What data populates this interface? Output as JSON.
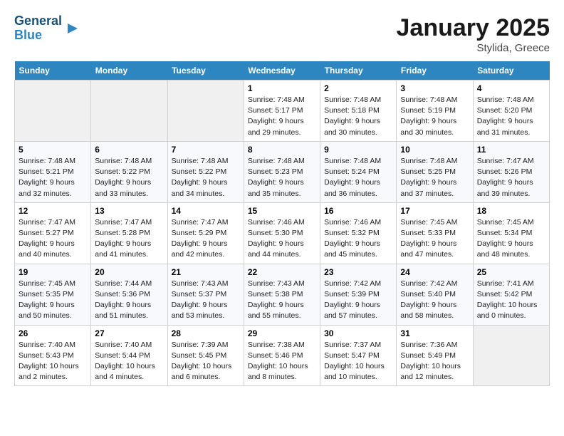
{
  "header": {
    "logo_line1": "General",
    "logo_line2": "Blue",
    "month": "January 2025",
    "location": "Stylida, Greece"
  },
  "weekdays": [
    "Sunday",
    "Monday",
    "Tuesday",
    "Wednesday",
    "Thursday",
    "Friday",
    "Saturday"
  ],
  "weeks": [
    [
      {
        "day": "",
        "info": ""
      },
      {
        "day": "",
        "info": ""
      },
      {
        "day": "",
        "info": ""
      },
      {
        "day": "1",
        "info": "Sunrise: 7:48 AM\nSunset: 5:17 PM\nDaylight: 9 hours\nand 29 minutes."
      },
      {
        "day": "2",
        "info": "Sunrise: 7:48 AM\nSunset: 5:18 PM\nDaylight: 9 hours\nand 30 minutes."
      },
      {
        "day": "3",
        "info": "Sunrise: 7:48 AM\nSunset: 5:19 PM\nDaylight: 9 hours\nand 30 minutes."
      },
      {
        "day": "4",
        "info": "Sunrise: 7:48 AM\nSunset: 5:20 PM\nDaylight: 9 hours\nand 31 minutes."
      }
    ],
    [
      {
        "day": "5",
        "info": "Sunrise: 7:48 AM\nSunset: 5:21 PM\nDaylight: 9 hours\nand 32 minutes."
      },
      {
        "day": "6",
        "info": "Sunrise: 7:48 AM\nSunset: 5:22 PM\nDaylight: 9 hours\nand 33 minutes."
      },
      {
        "day": "7",
        "info": "Sunrise: 7:48 AM\nSunset: 5:22 PM\nDaylight: 9 hours\nand 34 minutes."
      },
      {
        "day": "8",
        "info": "Sunrise: 7:48 AM\nSunset: 5:23 PM\nDaylight: 9 hours\nand 35 minutes."
      },
      {
        "day": "9",
        "info": "Sunrise: 7:48 AM\nSunset: 5:24 PM\nDaylight: 9 hours\nand 36 minutes."
      },
      {
        "day": "10",
        "info": "Sunrise: 7:48 AM\nSunset: 5:25 PM\nDaylight: 9 hours\nand 37 minutes."
      },
      {
        "day": "11",
        "info": "Sunrise: 7:47 AM\nSunset: 5:26 PM\nDaylight: 9 hours\nand 39 minutes."
      }
    ],
    [
      {
        "day": "12",
        "info": "Sunrise: 7:47 AM\nSunset: 5:27 PM\nDaylight: 9 hours\nand 40 minutes."
      },
      {
        "day": "13",
        "info": "Sunrise: 7:47 AM\nSunset: 5:28 PM\nDaylight: 9 hours\nand 41 minutes."
      },
      {
        "day": "14",
        "info": "Sunrise: 7:47 AM\nSunset: 5:29 PM\nDaylight: 9 hours\nand 42 minutes."
      },
      {
        "day": "15",
        "info": "Sunrise: 7:46 AM\nSunset: 5:30 PM\nDaylight: 9 hours\nand 44 minutes."
      },
      {
        "day": "16",
        "info": "Sunrise: 7:46 AM\nSunset: 5:32 PM\nDaylight: 9 hours\nand 45 minutes."
      },
      {
        "day": "17",
        "info": "Sunrise: 7:45 AM\nSunset: 5:33 PM\nDaylight: 9 hours\nand 47 minutes."
      },
      {
        "day": "18",
        "info": "Sunrise: 7:45 AM\nSunset: 5:34 PM\nDaylight: 9 hours\nand 48 minutes."
      }
    ],
    [
      {
        "day": "19",
        "info": "Sunrise: 7:45 AM\nSunset: 5:35 PM\nDaylight: 9 hours\nand 50 minutes."
      },
      {
        "day": "20",
        "info": "Sunrise: 7:44 AM\nSunset: 5:36 PM\nDaylight: 9 hours\nand 51 minutes."
      },
      {
        "day": "21",
        "info": "Sunrise: 7:43 AM\nSunset: 5:37 PM\nDaylight: 9 hours\nand 53 minutes."
      },
      {
        "day": "22",
        "info": "Sunrise: 7:43 AM\nSunset: 5:38 PM\nDaylight: 9 hours\nand 55 minutes."
      },
      {
        "day": "23",
        "info": "Sunrise: 7:42 AM\nSunset: 5:39 PM\nDaylight: 9 hours\nand 57 minutes."
      },
      {
        "day": "24",
        "info": "Sunrise: 7:42 AM\nSunset: 5:40 PM\nDaylight: 9 hours\nand 58 minutes."
      },
      {
        "day": "25",
        "info": "Sunrise: 7:41 AM\nSunset: 5:42 PM\nDaylight: 10 hours\nand 0 minutes."
      }
    ],
    [
      {
        "day": "26",
        "info": "Sunrise: 7:40 AM\nSunset: 5:43 PM\nDaylight: 10 hours\nand 2 minutes."
      },
      {
        "day": "27",
        "info": "Sunrise: 7:40 AM\nSunset: 5:44 PM\nDaylight: 10 hours\nand 4 minutes."
      },
      {
        "day": "28",
        "info": "Sunrise: 7:39 AM\nSunset: 5:45 PM\nDaylight: 10 hours\nand 6 minutes."
      },
      {
        "day": "29",
        "info": "Sunrise: 7:38 AM\nSunset: 5:46 PM\nDaylight: 10 hours\nand 8 minutes."
      },
      {
        "day": "30",
        "info": "Sunrise: 7:37 AM\nSunset: 5:47 PM\nDaylight: 10 hours\nand 10 minutes."
      },
      {
        "day": "31",
        "info": "Sunrise: 7:36 AM\nSunset: 5:49 PM\nDaylight: 10 hours\nand 12 minutes."
      },
      {
        "day": "",
        "info": ""
      }
    ]
  ]
}
